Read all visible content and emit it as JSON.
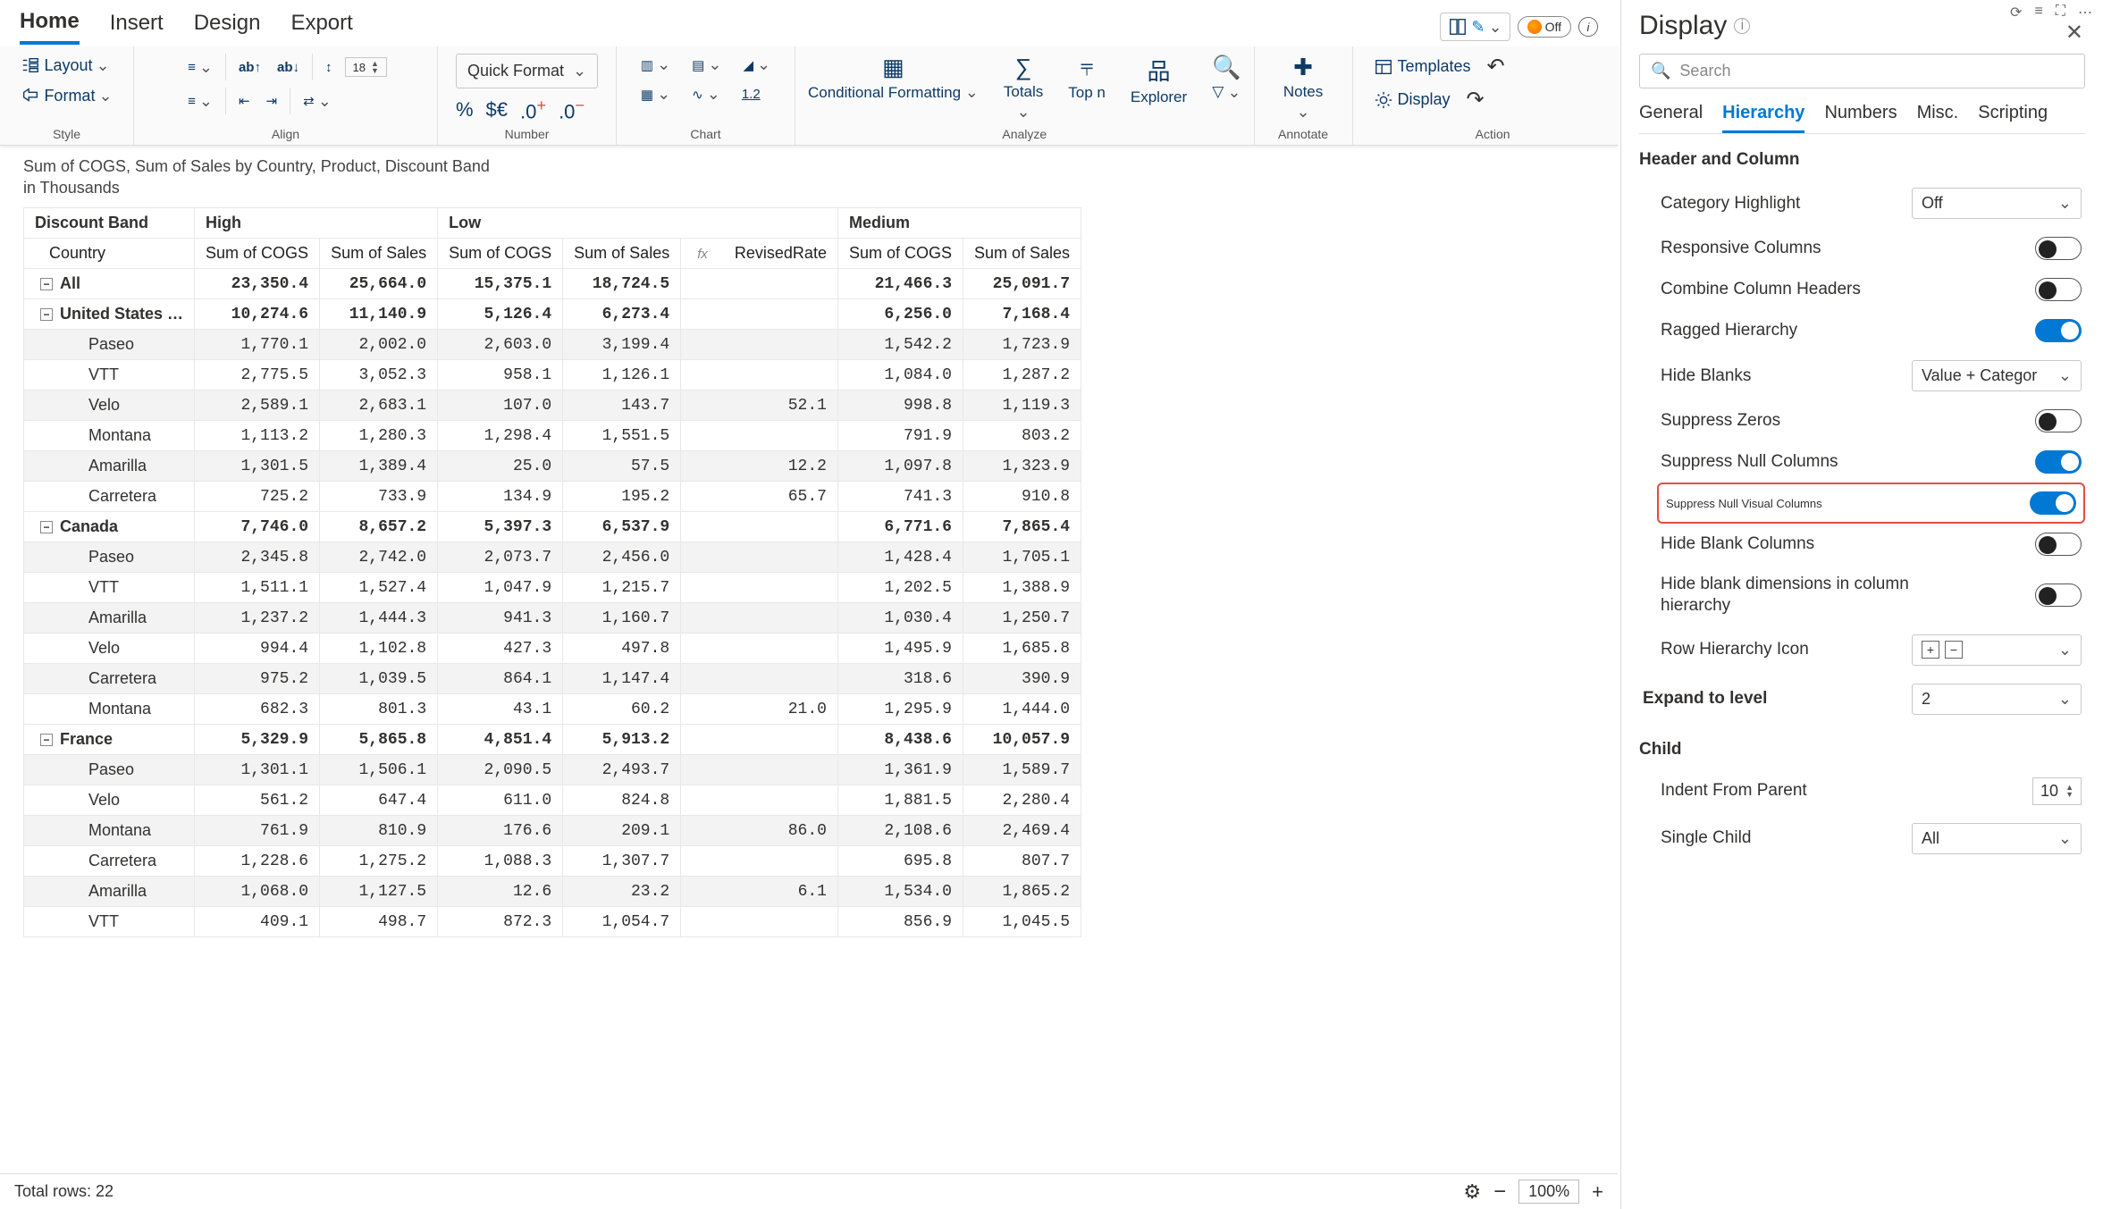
{
  "menu": {
    "tabs": [
      "Home",
      "Insert",
      "Design",
      "Export"
    ],
    "active": 0,
    "off_label": "Off"
  },
  "ribbon": {
    "layout": "Layout",
    "format": "Format",
    "style_label": "Style",
    "font_size": "18",
    "quick_format": "Quick Format",
    "align_label": "Align",
    "number_label": "Number",
    "chart_label": "Chart",
    "cond_fmt": "Conditional Formatting",
    "totals": "Totals",
    "topn": "Top n",
    "explorer": "Explorer",
    "analyze_label": "Analyze",
    "notes": "Notes",
    "annotate_label": "Annotate",
    "templates": "Templates",
    "display": "Display",
    "action_label": "Action",
    "onepointtwo": "1.2"
  },
  "report": {
    "title_line1": "Sum of COGS, Sum of  Sales by Country, Product, Discount Band",
    "title_line2": "in Thousands",
    "discount_band": "Discount Band",
    "bands": [
      "High",
      "Low",
      "Medium"
    ],
    "country_label": "Country",
    "col_cogs": "Sum of COGS",
    "col_sales": "Sum of Sales",
    "col_revised": "RevisedRate",
    "rows": [
      {
        "lvl": 0,
        "exp": true,
        "label": "All",
        "bold": true,
        "alt": false,
        "vals": [
          "23,350.4",
          "25,664.0",
          "15,375.1",
          "18,724.5",
          "",
          "21,466.3",
          "25,091.7"
        ]
      },
      {
        "lvl": 0,
        "exp": true,
        "label": "United States …",
        "bold": true,
        "alt": false,
        "vals": [
          "10,274.6",
          "11,140.9",
          "5,126.4",
          "6,273.4",
          "",
          "6,256.0",
          "7,168.4"
        ]
      },
      {
        "lvl": 1,
        "label": "Paseo",
        "alt": true,
        "vals": [
          "1,770.1",
          "2,002.0",
          "2,603.0",
          "3,199.4",
          "",
          "1,542.2",
          "1,723.9"
        ]
      },
      {
        "lvl": 1,
        "label": "VTT",
        "alt": false,
        "vals": [
          "2,775.5",
          "3,052.3",
          "958.1",
          "1,126.1",
          "",
          "1,084.0",
          "1,287.2"
        ]
      },
      {
        "lvl": 1,
        "label": "Velo",
        "alt": true,
        "vals": [
          "2,589.1",
          "2,683.1",
          "107.0",
          "143.7",
          "52.1",
          "998.8",
          "1,119.3"
        ]
      },
      {
        "lvl": 1,
        "label": "Montana",
        "alt": false,
        "vals": [
          "1,113.2",
          "1,280.3",
          "1,298.4",
          "1,551.5",
          "",
          "791.9",
          "803.2"
        ]
      },
      {
        "lvl": 1,
        "label": "Amarilla",
        "alt": true,
        "vals": [
          "1,301.5",
          "1,389.4",
          "25.0",
          "57.5",
          "12.2",
          "1,097.8",
          "1,323.9"
        ]
      },
      {
        "lvl": 1,
        "label": "Carretera",
        "alt": false,
        "vals": [
          "725.2",
          "733.9",
          "134.9",
          "195.2",
          "65.7",
          "741.3",
          "910.8"
        ]
      },
      {
        "lvl": 0,
        "exp": true,
        "label": "Canada",
        "bold": true,
        "alt": false,
        "vals": [
          "7,746.0",
          "8,657.2",
          "5,397.3",
          "6,537.9",
          "",
          "6,771.6",
          "7,865.4"
        ]
      },
      {
        "lvl": 1,
        "label": "Paseo",
        "alt": true,
        "vals": [
          "2,345.8",
          "2,742.0",
          "2,073.7",
          "2,456.0",
          "",
          "1,428.4",
          "1,705.1"
        ]
      },
      {
        "lvl": 1,
        "label": "VTT",
        "alt": false,
        "vals": [
          "1,511.1",
          "1,527.4",
          "1,047.9",
          "1,215.7",
          "",
          "1,202.5",
          "1,388.9"
        ]
      },
      {
        "lvl": 1,
        "label": "Amarilla",
        "alt": true,
        "vals": [
          "1,237.2",
          "1,444.3",
          "941.3",
          "1,160.7",
          "",
          "1,030.4",
          "1,250.7"
        ]
      },
      {
        "lvl": 1,
        "label": "Velo",
        "alt": false,
        "vals": [
          "994.4",
          "1,102.8",
          "427.3",
          "497.8",
          "",
          "1,495.9",
          "1,685.8"
        ]
      },
      {
        "lvl": 1,
        "label": "Carretera",
        "alt": true,
        "vals": [
          "975.2",
          "1,039.5",
          "864.1",
          "1,147.4",
          "",
          "318.6",
          "390.9"
        ]
      },
      {
        "lvl": 1,
        "label": "Montana",
        "alt": false,
        "vals": [
          "682.3",
          "801.3",
          "43.1",
          "60.2",
          "21.0",
          "1,295.9",
          "1,444.0"
        ]
      },
      {
        "lvl": 0,
        "exp": true,
        "label": "France",
        "bold": true,
        "alt": false,
        "vals": [
          "5,329.9",
          "5,865.8",
          "4,851.4",
          "5,913.2",
          "",
          "8,438.6",
          "10,057.9"
        ]
      },
      {
        "lvl": 1,
        "label": "Paseo",
        "alt": true,
        "vals": [
          "1,301.1",
          "1,506.1",
          "2,090.5",
          "2,493.7",
          "",
          "1,361.9",
          "1,589.7"
        ]
      },
      {
        "lvl": 1,
        "label": "Velo",
        "alt": false,
        "vals": [
          "561.2",
          "647.4",
          "611.0",
          "824.8",
          "",
          "1,881.5",
          "2,280.4"
        ]
      },
      {
        "lvl": 1,
        "label": "Montana",
        "alt": true,
        "vals": [
          "761.9",
          "810.9",
          "176.6",
          "209.1",
          "86.0",
          "2,108.6",
          "2,469.4"
        ]
      },
      {
        "lvl": 1,
        "label": "Carretera",
        "alt": false,
        "vals": [
          "1,228.6",
          "1,275.2",
          "1,088.3",
          "1,307.7",
          "",
          "695.8",
          "807.7"
        ]
      },
      {
        "lvl": 1,
        "label": "Amarilla",
        "alt": true,
        "vals": [
          "1,068.0",
          "1,127.5",
          "12.6",
          "23.2",
          "6.1",
          "1,534.0",
          "1,865.2"
        ]
      },
      {
        "lvl": 1,
        "label": "VTT",
        "alt": false,
        "vals": [
          "409.1",
          "498.7",
          "872.3",
          "1,054.7",
          "",
          "856.9",
          "1,045.5"
        ]
      }
    ]
  },
  "status": {
    "rows_label": "Total rows: 22",
    "zoom": "100%"
  },
  "panel": {
    "title": "Display",
    "search_placeholder": "Search",
    "tabs": [
      "General",
      "Hierarchy",
      "Numbers",
      "Misc.",
      "Scripting"
    ],
    "active": 1,
    "header_section": "Header and Column",
    "opts": {
      "category_highlight": {
        "label": "Category Highlight",
        "value": "Off"
      },
      "responsive_columns": {
        "label": "Responsive Columns",
        "on": false
      },
      "combine_headers": {
        "label": "Combine Column Headers",
        "on": false
      },
      "ragged": {
        "label": "Ragged Hierarchy",
        "on": true
      },
      "hide_blanks": {
        "label": "Hide Blanks",
        "value": "Value + Categor"
      },
      "suppress_zeros": {
        "label": "Suppress Zeros",
        "on": false
      },
      "suppress_null_cols": {
        "label": "Suppress Null Columns",
        "on": true
      },
      "suppress_null_visual": {
        "label": "Suppress Null Visual Columns",
        "on": true
      },
      "hide_blank_cols": {
        "label": "Hide Blank Columns",
        "on": false
      },
      "hide_blank_dims": {
        "label": "Hide blank dimensions in column hierarchy",
        "on": false
      },
      "row_hierarchy_icon": {
        "label": "Row Hierarchy Icon"
      },
      "expand_to_level": {
        "label": "Expand to level",
        "value": "2"
      },
      "child_section": "Child",
      "indent_from_parent": {
        "label": "Indent From Parent",
        "value": "10"
      },
      "single_child": {
        "label": "Single Child",
        "value": "All"
      }
    }
  }
}
